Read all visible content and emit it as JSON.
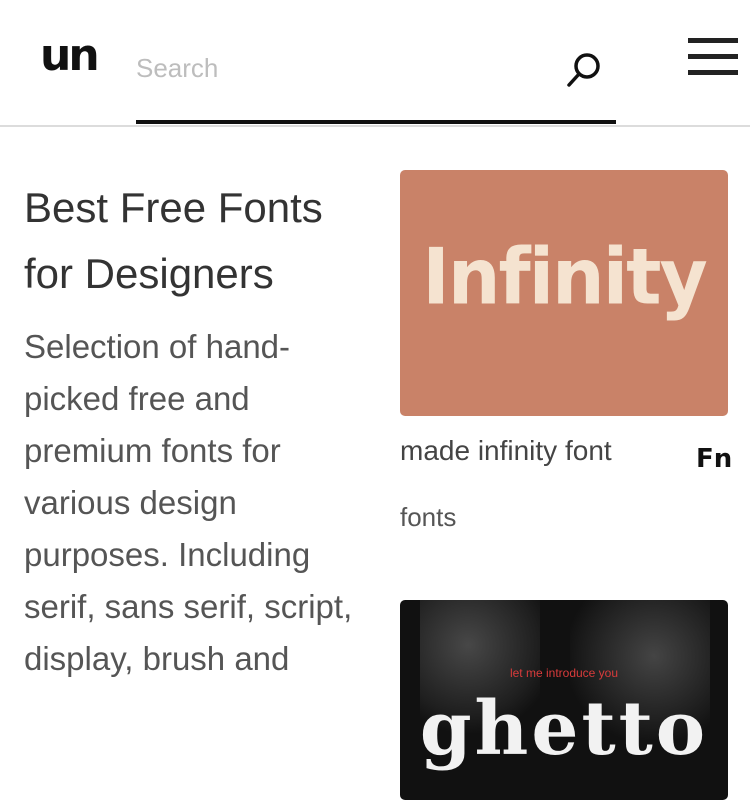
{
  "header": {
    "logo": "un",
    "search_placeholder": "Search",
    "search_icon": "search-icon",
    "menu_icon": "hamburger-menu-icon"
  },
  "intro": {
    "title_line1": "Best Free Fonts",
    "title_line2": "for Designers",
    "description": "Selection of hand-picked free and premium fonts for various design purposes. Including serif, sans serif, script, display, brush and"
  },
  "cards": [
    {
      "artwork_text": "Infinity",
      "title": "made infinity font",
      "tag": "fonts",
      "badge": "Fn",
      "bg_color": "#c98268"
    },
    {
      "artwork_subtext": "let me introduce you",
      "artwork_text": "ghetto",
      "bg_color": "#111111"
    }
  ]
}
